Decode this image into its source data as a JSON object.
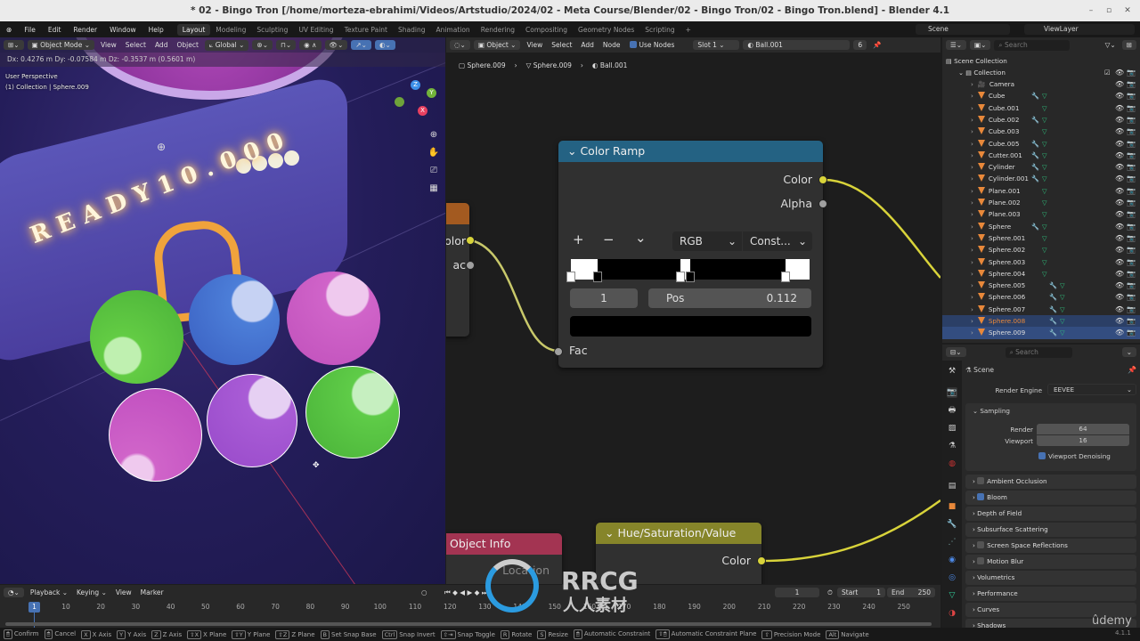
{
  "window": {
    "title": "* 02 - Bingo Tron [/home/morteza-ebrahimi/Videos/Artstudio/2024/02 - Meta Course/Blender/02 - Bingo Tron/02 - Bingo Tron.blend] - Blender 4.1",
    "minimize": "–",
    "maximize": "▫",
    "close": "✕"
  },
  "menu": {
    "items": [
      "File",
      "Edit",
      "Render",
      "Window",
      "Help"
    ],
    "workspaces": [
      "Layout",
      "Modeling",
      "Sculpting",
      "UV Editing",
      "Texture Paint",
      "Shading",
      "Animation",
      "Rendering",
      "Compositing",
      "Geometry Nodes",
      "Scripting",
      "+"
    ],
    "active_workspace": "Layout",
    "scene": "Scene",
    "view_layer": "ViewLayer"
  },
  "viewport": {
    "mode": "Object Mode",
    "menus": [
      "View",
      "Select",
      "Add",
      "Object"
    ],
    "orientation": "Global",
    "status": "Dx: 0.4276 m   Dy: -0.07584 m   Dz: -0.3537 m (0.5601 m)",
    "perspective": "User Perspective",
    "collection_info": "(1) Collection | Sphere.009",
    "sign_text": "READY10.000",
    "gizmo": {
      "x": "X",
      "y": "Y",
      "z": "Z"
    }
  },
  "node_editor": {
    "type": "Object",
    "menus": [
      "View",
      "Select",
      "Add",
      "Node"
    ],
    "use_nodes_label": "Use Nodes",
    "use_nodes": true,
    "slot": "Slot 1",
    "material": "Ball.001",
    "users": "6",
    "breadcrumb": [
      "Sphere.009",
      "Sphere.009",
      "Ball.001"
    ],
    "color_ramp": {
      "title": "Color Ramp",
      "out_color": "Color",
      "out_alpha": "Alpha",
      "color_mode": "RGB",
      "interpolation": "Const...",
      "add": "+",
      "remove": "−",
      "menu": "⌄",
      "index": "1",
      "pos_label": "Pos",
      "pos_value": "0.112",
      "in_fac": "Fac",
      "stops": [
        {
          "pos": 0.0,
          "color": "#ffffff"
        },
        {
          "pos": 0.112,
          "color": "#000000"
        },
        {
          "pos": 0.46,
          "color": "#ffffff"
        },
        {
          "pos": 0.5,
          "color": "#000000"
        },
        {
          "pos": 0.9,
          "color": "#ffffff"
        }
      ]
    },
    "left_node": {
      "out1": "olor",
      "out2": "ac"
    },
    "object_info": {
      "title": "Object Info",
      "out": "Location"
    },
    "hsv": {
      "title": "Hue/Saturation/Value",
      "out": "Color"
    }
  },
  "outliner": {
    "search_placeholder": "Search",
    "scene_collection": "Scene Collection",
    "collection": "Collection",
    "objects": [
      {
        "name": "Camera",
        "type": "camera"
      },
      {
        "name": "Cube",
        "mod": true
      },
      {
        "name": "Cube.001",
        "mod": false
      },
      {
        "name": "Cube.002",
        "mod": true
      },
      {
        "name": "Cube.003",
        "mod": false
      },
      {
        "name": "Cube.005",
        "mod": true
      },
      {
        "name": "Cutter.001",
        "mod": true
      },
      {
        "name": "Cylinder",
        "mod": true
      },
      {
        "name": "Cylinder.001",
        "mod": true
      },
      {
        "name": "Plane.001",
        "mod": false
      },
      {
        "name": "Plane.002",
        "mod": false
      },
      {
        "name": "Plane.003",
        "mod": false
      },
      {
        "name": "Sphere",
        "mod": true
      },
      {
        "name": "Sphere.001",
        "mod": false
      },
      {
        "name": "Sphere.002",
        "mod": false
      },
      {
        "name": "Sphere.003",
        "mod": false
      },
      {
        "name": "Sphere.004",
        "mod": false
      },
      {
        "name": "Sphere.005",
        "mod": true
      },
      {
        "name": "Sphere.006",
        "mod": true
      },
      {
        "name": "Sphere.007",
        "mod": true
      },
      {
        "name": "Sphere.008",
        "mod": true,
        "selected": true
      },
      {
        "name": "Sphere.009",
        "mod": true,
        "active": true
      }
    ]
  },
  "properties": {
    "search_placeholder": "Search",
    "context": "Scene",
    "render_engine_label": "Render Engine",
    "render_engine": "EEVEE",
    "sampling": "Sampling",
    "render_label": "Render",
    "render_value": "64",
    "viewport_label": "Viewport",
    "viewport_value": "16",
    "viewport_denoising": "Viewport Denoising",
    "panels": [
      {
        "label": "Ambient Occlusion",
        "checkbox": false
      },
      {
        "label": "Bloom",
        "checkbox": true
      },
      {
        "label": "Depth of Field"
      },
      {
        "label": "Subsurface Scattering"
      },
      {
        "label": "Screen Space Reflections",
        "checkbox": false
      },
      {
        "label": "Motion Blur",
        "checkbox": false
      },
      {
        "label": "Volumetrics"
      },
      {
        "label": "Performance"
      },
      {
        "label": "Curves"
      },
      {
        "label": "Shadows"
      }
    ]
  },
  "timeline": {
    "menus": [
      "Playback",
      "Keying",
      "View",
      "Marker"
    ],
    "current_frame": "1",
    "start_label": "Start",
    "start": "1",
    "end_label": "End",
    "end": "250",
    "ticks": [
      "10",
      "20",
      "30",
      "40",
      "50",
      "60",
      "70",
      "80",
      "90",
      "100",
      "110",
      "120",
      "130",
      "140",
      "150",
      "160",
      "170",
      "180",
      "190",
      "200",
      "210",
      "220",
      "230",
      "240",
      "250"
    ]
  },
  "statusbar": [
    {
      "key": "🖱",
      "label": "Confirm"
    },
    {
      "key": "🖱",
      "label": "Cancel"
    },
    {
      "key": "X",
      "label": "X Axis"
    },
    {
      "key": "Y",
      "label": "Y Axis"
    },
    {
      "key": "Z",
      "label": "Z Axis"
    },
    {
      "key": "⇧X",
      "label": "X Plane"
    },
    {
      "key": "⇧Y",
      "label": "Y Plane"
    },
    {
      "key": "⇧Z",
      "label": "Z Plane"
    },
    {
      "key": "B",
      "label": "Set Snap Base"
    },
    {
      "key": "Ctrl",
      "label": "Snap Invert"
    },
    {
      "key": "⇧⇥",
      "label": "Snap Toggle"
    },
    {
      "key": "R",
      "label": "Rotate"
    },
    {
      "key": "S",
      "label": "Resize"
    },
    {
      "key": "🖱",
      "label": "Automatic Constraint"
    },
    {
      "key": "⇧🖱",
      "label": "Automatic Constraint Plane"
    },
    {
      "key": "⇧",
      "label": "Precision Mode"
    },
    {
      "key": "Alt",
      "label": "Navigate"
    }
  ],
  "watermark": {
    "brand": "RRCG",
    "sub": "人人素材",
    "udemy": "ûdemy",
    "version": "4.1.1"
  }
}
